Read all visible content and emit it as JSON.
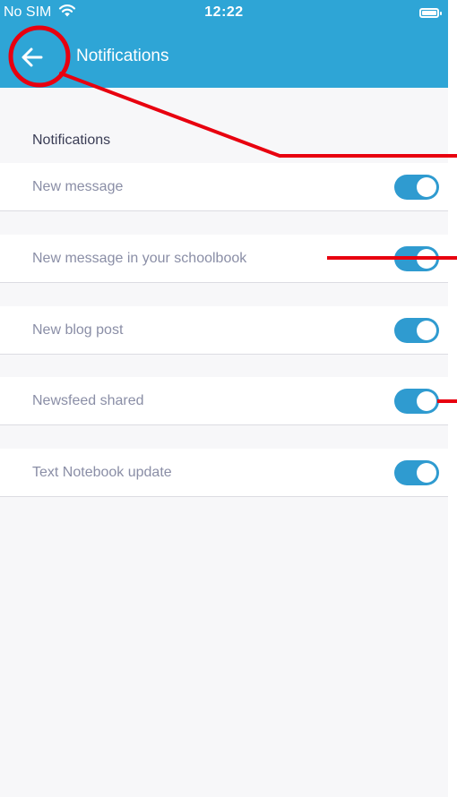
{
  "status_bar": {
    "carrier": "No SIM",
    "time": "12:22",
    "wifi_icon": "wifi-icon",
    "battery_icon": "battery-icon"
  },
  "app_bar": {
    "title": "Notifications",
    "back_icon": "arrow-left-icon"
  },
  "section": {
    "title": "Notifications"
  },
  "settings": [
    {
      "label": "New message",
      "enabled": true
    },
    {
      "label": "New message in your schoolbook",
      "enabled": true
    },
    {
      "label": "New blog post",
      "enabled": true
    },
    {
      "label": "Newsfeed shared",
      "enabled": true
    },
    {
      "label": "Text Notebook update",
      "enabled": true
    }
  ],
  "colors": {
    "primary": "#2ea5d6",
    "toggle_on": "#2f9bd0",
    "annotation": "#e8000f",
    "background": "#f7f7f9"
  }
}
